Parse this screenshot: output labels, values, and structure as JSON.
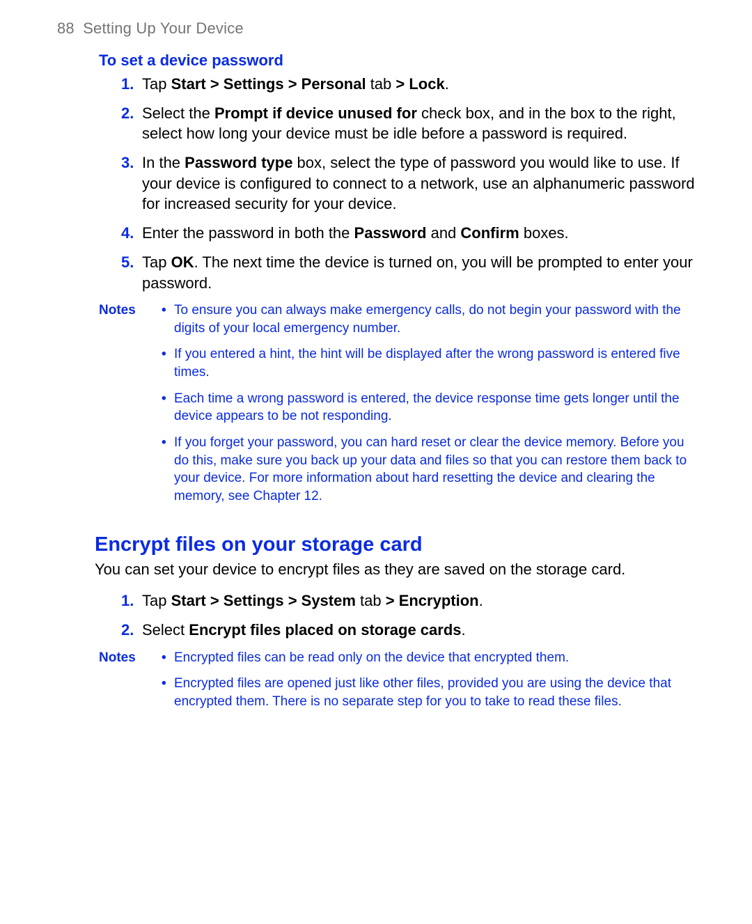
{
  "header": {
    "page_number": "88",
    "title": "Setting Up Your Device"
  },
  "section1": {
    "heading": "To set a device password",
    "steps": [
      {
        "parts": [
          {
            "t": "Tap ",
            "b": false
          },
          {
            "t": "Start > Settings > Personal",
            "b": true
          },
          {
            "t": " tab ",
            "b": false
          },
          {
            "t": "> Lock",
            "b": true
          },
          {
            "t": ".",
            "b": false
          }
        ]
      },
      {
        "parts": [
          {
            "t": "Select the ",
            "b": false
          },
          {
            "t": "Prompt if device unused for",
            "b": true
          },
          {
            "t": " check box, and in the box to the right, select how long your device must be idle before a password is required.",
            "b": false
          }
        ]
      },
      {
        "parts": [
          {
            "t": "In the ",
            "b": false
          },
          {
            "t": "Password type",
            "b": true
          },
          {
            "t": " box, select the type of password you would like to use. If your device is configured to connect to a network, use an alphanumeric password for increased security for your device.",
            "b": false
          }
        ]
      },
      {
        "parts": [
          {
            "t": "Enter the password in both the ",
            "b": false
          },
          {
            "t": "Password",
            "b": true
          },
          {
            "t": " and ",
            "b": false
          },
          {
            "t": "Confirm",
            "b": true
          },
          {
            "t": " boxes.",
            "b": false
          }
        ]
      },
      {
        "parts": [
          {
            "t": "Tap ",
            "b": false
          },
          {
            "t": "OK",
            "b": true
          },
          {
            "t": ". The next time the device is turned on, you will be prompted to enter your password.",
            "b": false
          }
        ]
      }
    ],
    "notes_label": "Notes",
    "notes": [
      "To ensure you can always make emergency calls, do not begin your password with the digits of your local emergency number.",
      "If you entered a hint, the hint will be displayed after the wrong password is entered five times.",
      "Each time a wrong password is entered, the device response time gets longer until the device appears to be not responding.",
      "If you forget your password, you can hard reset or clear the device memory. Before you do this, make sure you back up your data and files so that you can restore them back to your device. For more information about hard resetting the device and clearing the memory, see Chapter 12."
    ]
  },
  "section2": {
    "heading": "Encrypt files on your storage card",
    "intro": "You can set your device to encrypt files as they are saved on the storage card.",
    "steps": [
      {
        "parts": [
          {
            "t": "Tap ",
            "b": false
          },
          {
            "t": "Start > Settings > System",
            "b": true
          },
          {
            "t": " tab ",
            "b": false
          },
          {
            "t": "> Encryption",
            "b": true
          },
          {
            "t": ".",
            "b": false
          }
        ]
      },
      {
        "parts": [
          {
            "t": "Select ",
            "b": false
          },
          {
            "t": "Encrypt files placed on storage cards",
            "b": true
          },
          {
            "t": ".",
            "b": false
          }
        ]
      }
    ],
    "notes_label": "Notes",
    "notes": [
      "Encrypted files can be read only on the device that encrypted them.",
      "Encrypted files are opened just like other files, provided you are using the device that encrypted them. There is no separate step for you to take to read these files."
    ]
  }
}
